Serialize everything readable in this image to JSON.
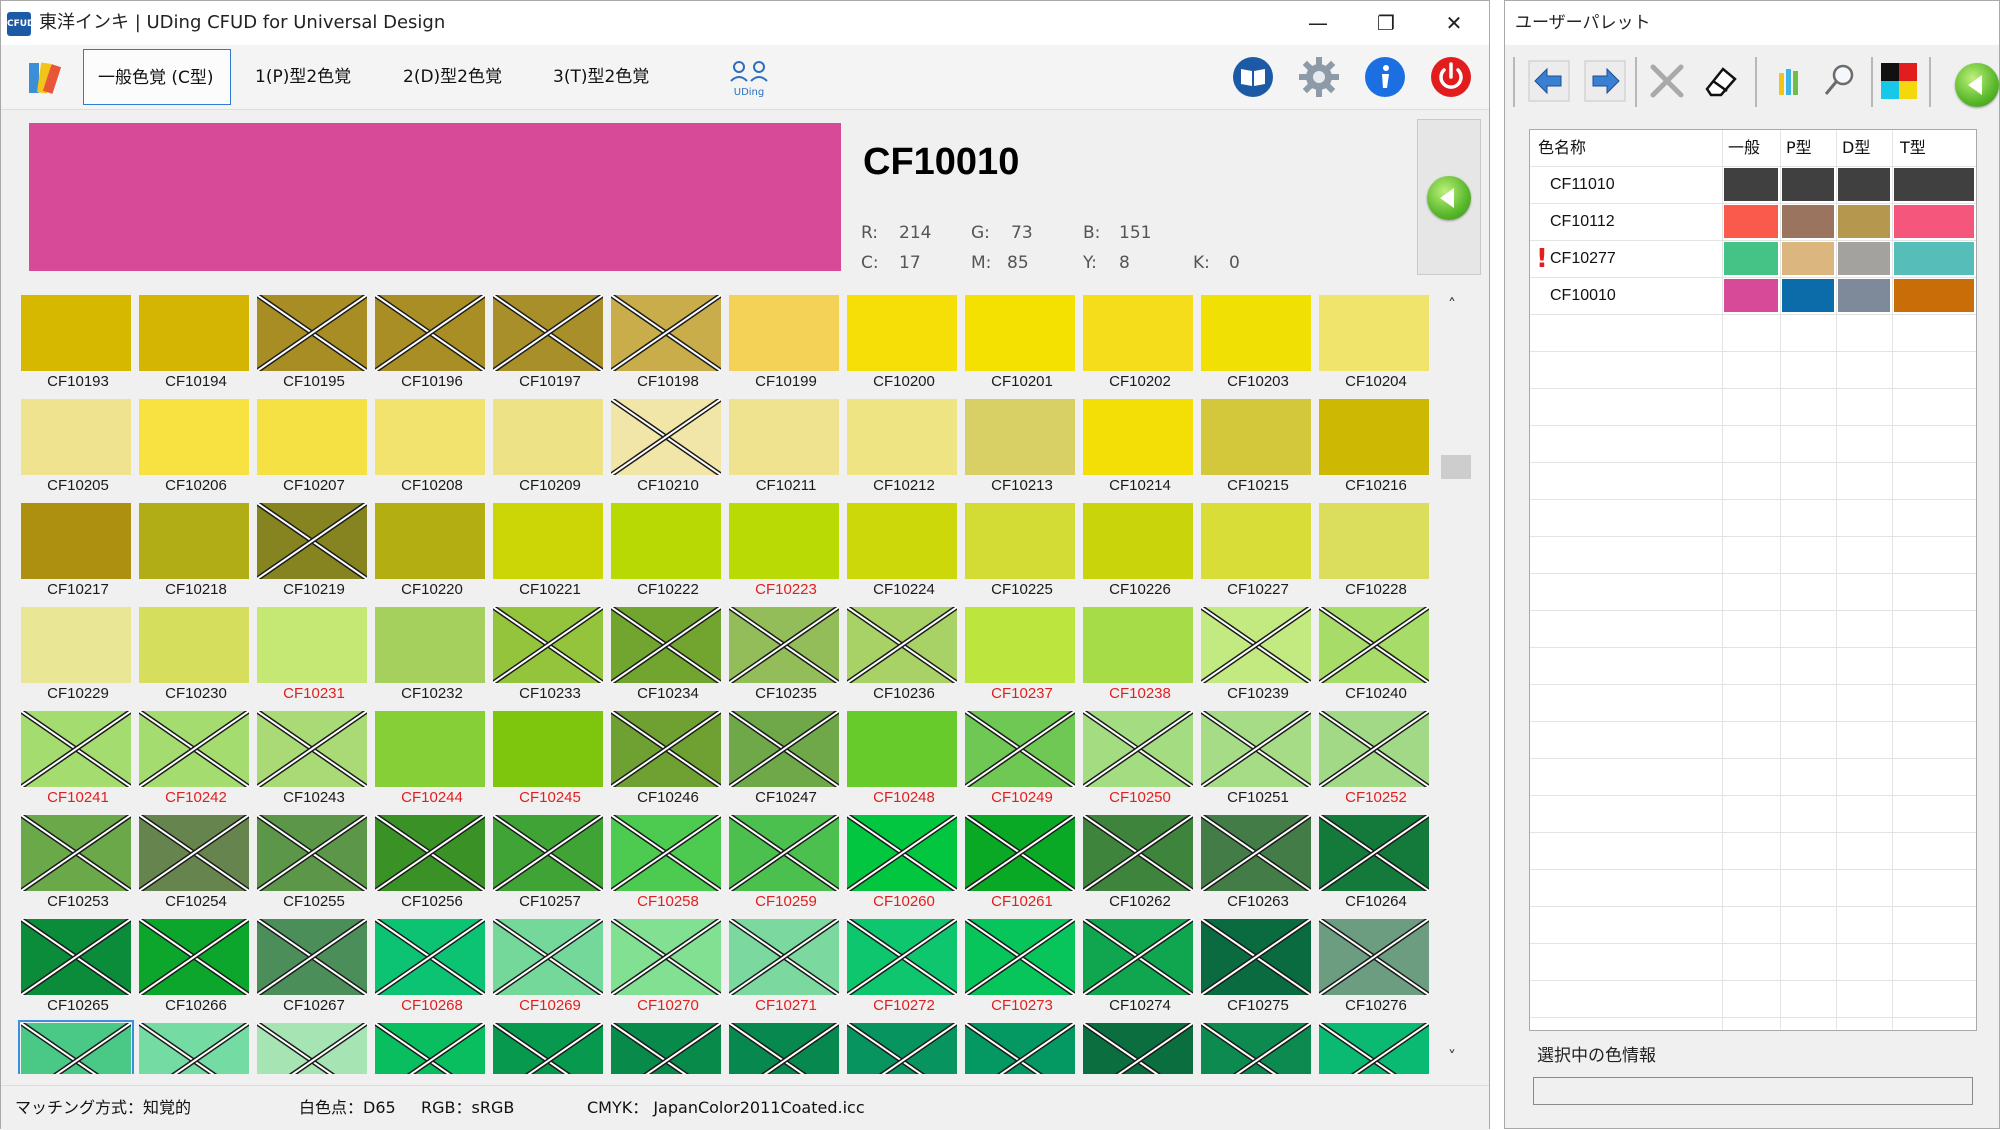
{
  "main": {
    "title": "東洋インキ | UDing CFUD for Universal Design",
    "app_icon_text": "CFUD",
    "window_controls": {
      "minimize": "—",
      "restore": "❐",
      "close": "✕"
    },
    "tabs": [
      {
        "label": "一般色覚 (C型)",
        "active": true
      },
      {
        "label": "1(P)型2色覚",
        "active": false
      },
      {
        "label": "2(D)型2色覚",
        "active": false
      },
      {
        "label": "3(T)型2色覚",
        "active": false
      }
    ],
    "toolbar_icons": [
      "uding-logo-icon",
      "book-icon",
      "gear-icon",
      "info-icon",
      "power-icon"
    ],
    "uding_logo_text": "UDing",
    "selected": {
      "name": "CF10010",
      "color": "#d64a97",
      "r_label": "R:",
      "r": "214",
      "g_label": "G:",
      "g": "73",
      "b_label": "B:",
      "b": "151",
      "c_label": "C:",
      "c": "17",
      "m_label": "M:",
      "m": "85",
      "y_label": "Y:",
      "y": "8",
      "k_label": "K:",
      "k": "0"
    },
    "status": {
      "matching": "マッチング方式：知覚的",
      "whitepoint": "白色点：D65",
      "rgb": "RGB：sRGB",
      "cmyk": "CMYK： JapanColor2011Coated.icc"
    },
    "scroll": {
      "up": "˄",
      "down": "˅"
    }
  },
  "swatches": [
    {
      "name": "CF10193",
      "color": "#d6b800",
      "x": false,
      "red": false
    },
    {
      "name": "CF10194",
      "color": "#d4b503",
      "x": false,
      "red": false
    },
    {
      "name": "CF10195",
      "color": "#a88d25",
      "x": true,
      "red": false
    },
    {
      "name": "CF10196",
      "color": "#a98e26",
      "x": true,
      "red": false
    },
    {
      "name": "CF10197",
      "color": "#a88f2a",
      "x": true,
      "red": false
    },
    {
      "name": "CF10198",
      "color": "#c8ad4a",
      "x": true,
      "red": false
    },
    {
      "name": "CF10199",
      "color": "#f4d258",
      "x": false,
      "red": false
    },
    {
      "name": "CF10200",
      "color": "#f5df06",
      "x": false,
      "red": false
    },
    {
      "name": "CF10201",
      "color": "#f4e102",
      "x": false,
      "red": false
    },
    {
      "name": "CF10202",
      "color": "#f5dd1c",
      "x": false,
      "red": false
    },
    {
      "name": "CF10203",
      "color": "#f1e004",
      "x": false,
      "red": false
    },
    {
      "name": "CF10204",
      "color": "#f1e46c",
      "x": false,
      "red": false
    },
    {
      "name": "CF10205",
      "color": "#efe38f",
      "x": false,
      "red": false
    },
    {
      "name": "CF10206",
      "color": "#f7e241",
      "x": false,
      "red": false
    },
    {
      "name": "CF10207",
      "color": "#f5e144",
      "x": false,
      "red": false
    },
    {
      "name": "CF10208",
      "color": "#f1e36d",
      "x": false,
      "red": false
    },
    {
      "name": "CF10209",
      "color": "#eee286",
      "x": false,
      "red": false
    },
    {
      "name": "CF10210",
      "color": "#f1e6a7",
      "x": true,
      "red": false
    },
    {
      "name": "CF10211",
      "color": "#efe390",
      "x": false,
      "red": false
    },
    {
      "name": "CF10212",
      "color": "#efe484",
      "x": false,
      "red": false
    },
    {
      "name": "CF10213",
      "color": "#d8d064",
      "x": false,
      "red": false
    },
    {
      "name": "CF10214",
      "color": "#f3df06",
      "x": false,
      "red": false
    },
    {
      "name": "CF10215",
      "color": "#d3c83c",
      "x": false,
      "red": false
    },
    {
      "name": "CF10216",
      "color": "#cdb904",
      "x": false,
      "red": false
    },
    {
      "name": "CF10217",
      "color": "#ae9010",
      "x": false,
      "red": false
    },
    {
      "name": "CF10218",
      "color": "#b1ad16",
      "x": false,
      "red": false
    },
    {
      "name": "CF10219",
      "color": "#868421",
      "x": true,
      "red": false
    },
    {
      "name": "CF10220",
      "color": "#b3af13",
      "x": false,
      "red": false
    },
    {
      "name": "CF10221",
      "color": "#ccd607",
      "x": false,
      "red": false
    },
    {
      "name": "CF10222",
      "color": "#b8d904",
      "x": false,
      "red": false
    },
    {
      "name": "CF10223",
      "color": "#b9da04",
      "x": false,
      "red": true
    },
    {
      "name": "CF10224",
      "color": "#cdd80a",
      "x": false,
      "red": false
    },
    {
      "name": "CF10225",
      "color": "#d3dc34",
      "x": false,
      "red": false
    },
    {
      "name": "CF10226",
      "color": "#c9d40a",
      "x": false,
      "red": false
    },
    {
      "name": "CF10227",
      "color": "#d9dd38",
      "x": false,
      "red": false
    },
    {
      "name": "CF10228",
      "color": "#dbdd5c",
      "x": false,
      "red": false
    },
    {
      "name": "CF10229",
      "color": "#e9e696",
      "x": false,
      "red": false
    },
    {
      "name": "CF10230",
      "color": "#d6de5e",
      "x": false,
      "red": false
    },
    {
      "name": "CF10231",
      "color": "#c5e874",
      "x": false,
      "red": true
    },
    {
      "name": "CF10232",
      "color": "#a6d05e",
      "x": false,
      "red": false
    },
    {
      "name": "CF10233",
      "color": "#94c43c",
      "x": true,
      "red": false
    },
    {
      "name": "CF10234",
      "color": "#72a530",
      "x": true,
      "red": false
    },
    {
      "name": "CF10235",
      "color": "#93bd59",
      "x": true,
      "red": false
    },
    {
      "name": "CF10236",
      "color": "#a8d266",
      "x": true,
      "red": false
    },
    {
      "name": "CF10237",
      "color": "#bce63e",
      "x": false,
      "red": true
    },
    {
      "name": "CF10238",
      "color": "#a6dc48",
      "x": false,
      "red": true
    },
    {
      "name": "CF10239",
      "color": "#c2ea80",
      "x": true,
      "red": false
    },
    {
      "name": "CF10240",
      "color": "#a8dc68",
      "x": true,
      "red": false
    },
    {
      "name": "CF10241",
      "color": "#a5dc6f",
      "x": true,
      "red": true
    },
    {
      "name": "CF10242",
      "color": "#a5dc6f",
      "x": true,
      "red": true
    },
    {
      "name": "CF10243",
      "color": "#a9da76",
      "x": true,
      "red": false
    },
    {
      "name": "CF10244",
      "color": "#86cf36",
      "x": false,
      "red": true
    },
    {
      "name": "CF10245",
      "color": "#7ec60e",
      "x": false,
      "red": true
    },
    {
      "name": "CF10246",
      "color": "#6ea131",
      "x": true,
      "red": false
    },
    {
      "name": "CF10247",
      "color": "#6ea849",
      "x": true,
      "red": false
    },
    {
      "name": "CF10248",
      "color": "#68cb2c",
      "x": false,
      "red": true
    },
    {
      "name": "CF10249",
      "color": "#6fc754",
      "x": true,
      "red": true
    },
    {
      "name": "CF10250",
      "color": "#a4dc82",
      "x": true,
      "red": true
    },
    {
      "name": "CF10251",
      "color": "#a7dc86",
      "x": true,
      "red": false
    },
    {
      "name": "CF10252",
      "color": "#a2d987",
      "x": true,
      "red": true
    },
    {
      "name": "CF10253",
      "color": "#6aa84a",
      "x": true,
      "red": false
    },
    {
      "name": "CF10254",
      "color": "#66854e",
      "x": true,
      "red": false
    },
    {
      "name": "CF10255",
      "color": "#5c9649",
      "x": true,
      "red": false
    },
    {
      "name": "CF10256",
      "color": "#3a9126",
      "x": true,
      "red": false
    },
    {
      "name": "CF10257",
      "color": "#40a336",
      "x": true,
      "red": false
    },
    {
      "name": "CF10258",
      "color": "#4ccb50",
      "x": true,
      "red": true
    },
    {
      "name": "CF10259",
      "color": "#4cc04e",
      "x": true,
      "red": true
    },
    {
      "name": "CF10260",
      "color": "#02c63f",
      "x": true,
      "red": true
    },
    {
      "name": "CF10261",
      "color": "#09a825",
      "x": true,
      "red": true
    },
    {
      "name": "CF10262",
      "color": "#3e843c",
      "x": true,
      "red": false
    },
    {
      "name": "CF10263",
      "color": "#447c48",
      "x": true,
      "red": false
    },
    {
      "name": "CF10264",
      "color": "#147a3c",
      "x": true,
      "red": false
    },
    {
      "name": "CF10265",
      "color": "#0a8c3a",
      "x": true,
      "red": false
    },
    {
      "name": "CF10266",
      "color": "#0ba62b",
      "x": true,
      "red": false
    },
    {
      "name": "CF10267",
      "color": "#4b8e59",
      "x": true,
      "red": false
    },
    {
      "name": "CF10268",
      "color": "#0cc374",
      "x": true,
      "red": true
    },
    {
      "name": "CF10269",
      "color": "#73d89a",
      "x": true,
      "red": true
    },
    {
      "name": "CF10270",
      "color": "#82e092",
      "x": true,
      "red": true
    },
    {
      "name": "CF10271",
      "color": "#7bd9a0",
      "x": true,
      "red": true
    },
    {
      "name": "CF10272",
      "color": "#0ec66e",
      "x": true,
      "red": true
    },
    {
      "name": "CF10273",
      "color": "#07c55a",
      "x": true,
      "red": true
    },
    {
      "name": "CF10274",
      "color": "#10a64f",
      "x": true,
      "red": false
    },
    {
      "name": "CF10275",
      "color": "#0a6b40",
      "x": true,
      "red": false
    },
    {
      "name": "CF10276",
      "color": "#6c9d80",
      "x": true,
      "red": false
    },
    {
      "name": "",
      "color": "#4ac886",
      "x": true,
      "red": false,
      "selected": true
    },
    {
      "name": "",
      "color": "#74dca2",
      "x": true,
      "red": false
    },
    {
      "name": "",
      "color": "#a6e4b4",
      "x": true,
      "red": false
    },
    {
      "name": "",
      "color": "#08be5e",
      "x": true,
      "red": false
    },
    {
      "name": "",
      "color": "#079a4e",
      "x": true,
      "red": false
    },
    {
      "name": "",
      "color": "#078a4a",
      "x": true,
      "red": false
    },
    {
      "name": "",
      "color": "#06884e",
      "x": true,
      "red": false
    },
    {
      "name": "",
      "color": "#07945f",
      "x": true,
      "red": false
    },
    {
      "name": "",
      "color": "#049863",
      "x": true,
      "red": false
    },
    {
      "name": "",
      "color": "#0a6e3e",
      "x": true,
      "red": false
    },
    {
      "name": "",
      "color": "#0c8a50",
      "x": true,
      "red": false
    },
    {
      "name": "",
      "color": "#0bba72",
      "x": true,
      "red": false
    }
  ],
  "palette": {
    "title": "ユーザーパレット",
    "tools": [
      "back-arrow-icon",
      "forward-arrow-icon",
      "delete-icon",
      "eraser-icon",
      "pencils-icon",
      "magnifier-icon",
      "color-blocks-icon",
      "send-arrow-icon"
    ],
    "columns": [
      "色名称",
      "一般",
      "P型",
      "D型",
      "T型"
    ],
    "rows": [
      {
        "name": "CF11010",
        "warn": false,
        "colors": [
          "#404040",
          "#404040",
          "#404040",
          "#404040"
        ]
      },
      {
        "name": "CF10112",
        "warn": false,
        "colors": [
          "#fa5a4c",
          "#9b7460",
          "#b5984e",
          "#f5577c"
        ]
      },
      {
        "name": "CF10277",
        "warn": true,
        "colors": [
          "#45c386",
          "#dbb67e",
          "#a4a29f",
          "#56bdb8"
        ]
      },
      {
        "name": "CF10010",
        "warn": false,
        "colors": [
          "#d64a97",
          "#0c6ba9",
          "#7e8a99",
          "#c96d08"
        ]
      }
    ],
    "warn_symbol": "!",
    "info_label": "選択中の色情報"
  }
}
